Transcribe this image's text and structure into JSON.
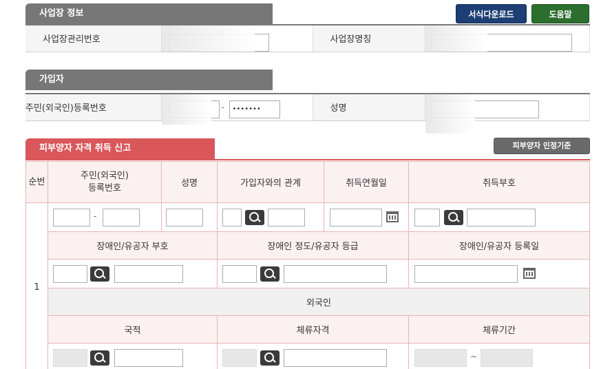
{
  "sections": {
    "workplace": {
      "title": "사업장 정보",
      "mgmt_no_label": "사업장관리번호",
      "name_label": "사업장명칭"
    },
    "subscriber": {
      "title": "가입자",
      "rrn_label": "주민(외국인)등록번호",
      "rrn_masked": "•••••••",
      "name_label": "성명"
    },
    "dependent": {
      "title": "피부양자 자격 취득 신고"
    }
  },
  "buttons": {
    "download": "서식다운로드",
    "help": "도움말",
    "criteria": "피부양자 인정기준"
  },
  "grid": {
    "headers1": {
      "seq": "순번",
      "rrn": "주민(외국인)\n등록번호",
      "name": "성명",
      "relation": "가입자와의 관계",
      "acq_date": "취득연월일",
      "acq_code": "취득부호"
    },
    "row_no": "1",
    "headers2": {
      "disab_code": "장애인/유공자 부호",
      "disab_grade": "장애인 정도/유공자 등급",
      "disab_date": "장애인/유공자 등록일"
    },
    "foreigner": "외국인",
    "headers3": {
      "nationality": "국적",
      "stay_status": "체류자격",
      "stay_period": "체류기간"
    },
    "dash": "-",
    "tilde": "~"
  }
}
